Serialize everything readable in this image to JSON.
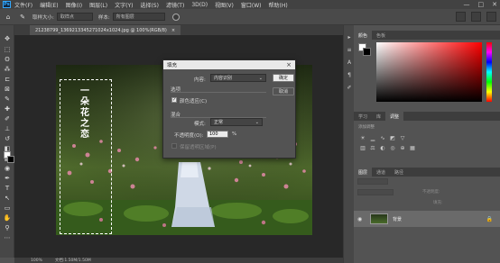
{
  "menubar": {
    "logo": "Ps",
    "items": [
      "文件(F)",
      "编辑(E)",
      "图像(I)",
      "图层(L)",
      "文字(Y)",
      "选择(S)",
      "滤镜(T)",
      "3D(D)",
      "视图(V)",
      "窗口(W)",
      "帮助(H)"
    ],
    "window_controls": [
      "—",
      "□",
      "✕"
    ]
  },
  "optionsbar": {
    "size_label": "取样大小:",
    "size_value": "取样点",
    "sample_label": "样本:",
    "sample_value": "所有图层"
  },
  "document": {
    "tab_title": "21238799_1369213345271024x1024.jpg @ 100%(RGB/8)",
    "vertical_text": [
      "一",
      "朵",
      "花",
      "之",
      "恋"
    ]
  },
  "statusbar": {
    "zoom": "100%",
    "info": "文档:1.50M/1.50M"
  },
  "color_panel": {
    "tabs": [
      "颜色",
      "色板"
    ]
  },
  "adjust_panel": {
    "tabs": [
      "学习",
      "库",
      "调整"
    ],
    "title": "添加调整"
  },
  "layers_panel": {
    "tabs": [
      "图层",
      "通道",
      "路径"
    ],
    "layer_name": "背景",
    "opacity_label": "不透明度:",
    "fill_label": "填充:"
  },
  "dialog": {
    "title": "填充",
    "content_label": "内容:",
    "content_value": "内容识别",
    "ok": "确定",
    "cancel": "取消",
    "options_heading": "选项",
    "color_adapt": "颜色适应(C)",
    "blend_heading": "混合",
    "mode_label": "模式:",
    "mode_value": "正常",
    "opacity_label": "不透明度(O):",
    "opacity_value": "100",
    "opacity_unit": "%",
    "preserve_transparency": "保留透明区域(P)"
  }
}
